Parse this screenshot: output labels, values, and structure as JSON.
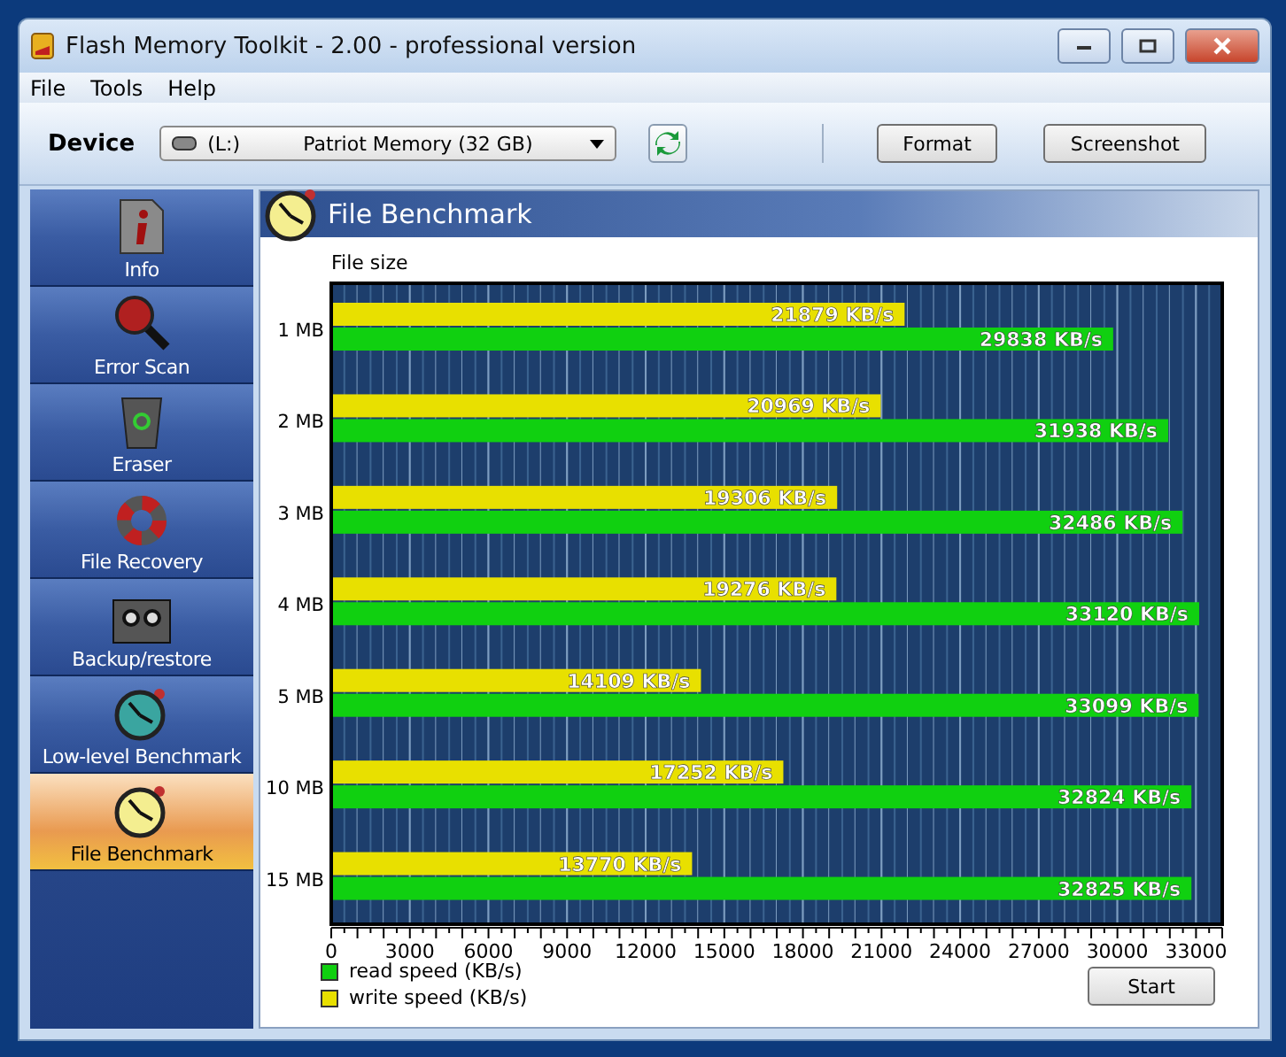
{
  "window": {
    "title": "Flash Memory Toolkit - 2.00 - professional version"
  },
  "menu": [
    "File",
    "Tools",
    "Help"
  ],
  "toolbar": {
    "device_label": "Device",
    "drive_letter": "(L:)",
    "device": "Patriot Memory (32 GB)",
    "buttons": [
      "Format",
      "Screenshot"
    ]
  },
  "sidebar": {
    "items": [
      {
        "label": "Info",
        "kind": "info",
        "selected": false
      },
      {
        "label": "Error Scan",
        "kind": "scan",
        "selected": false
      },
      {
        "label": "Eraser",
        "kind": "eraser",
        "selected": false
      },
      {
        "label": "File Recovery",
        "kind": "recovery",
        "selected": false
      },
      {
        "label": "Backup/restore",
        "kind": "backup",
        "selected": false
      },
      {
        "label": "Low-level Benchmark",
        "kind": "lowlevel",
        "selected": false
      },
      {
        "label": "File Benchmark",
        "kind": "benchmark",
        "selected": true
      }
    ]
  },
  "panel": {
    "title": "File Benchmark",
    "chart_data": {
      "type": "bar",
      "orientation": "horizontal",
      "ylabel": "File size",
      "categories": [
        "1 MB",
        "2 MB",
        "3 MB",
        "4 MB",
        "5 MB",
        "10 MB",
        "15 MB"
      ],
      "series": [
        {
          "name": "write speed (KB/s)",
          "color": "#e8e000",
          "values": [
            21879,
            20969,
            19306,
            19276,
            14109,
            17252,
            13770
          ]
        },
        {
          "name": "read speed (KB/s)",
          "color": "#10d010",
          "values": [
            29838,
            31938,
            32486,
            33120,
            33099,
            32824,
            32825
          ]
        }
      ],
      "value_labels": [
        [
          "21879 KB/s",
          "20969 KB/s",
          "19306 KB/s",
          "19276 KB/s",
          "14109 KB/s",
          "17252 KB/s",
          "13770 KB/s"
        ],
        [
          "29838 KB/s",
          "31938 KB/s",
          "32486 KB/s",
          "33120 KB/s",
          "33099 KB/s",
          "32824 KB/s",
          "32825 KB/s"
        ]
      ],
      "xlim": [
        0,
        34000
      ],
      "grid": true,
      "xticks": [
        0,
        3000,
        6000,
        9000,
        12000,
        15000,
        18000,
        21000,
        24000,
        27000,
        30000,
        33000
      ]
    },
    "start_button": "Start"
  }
}
